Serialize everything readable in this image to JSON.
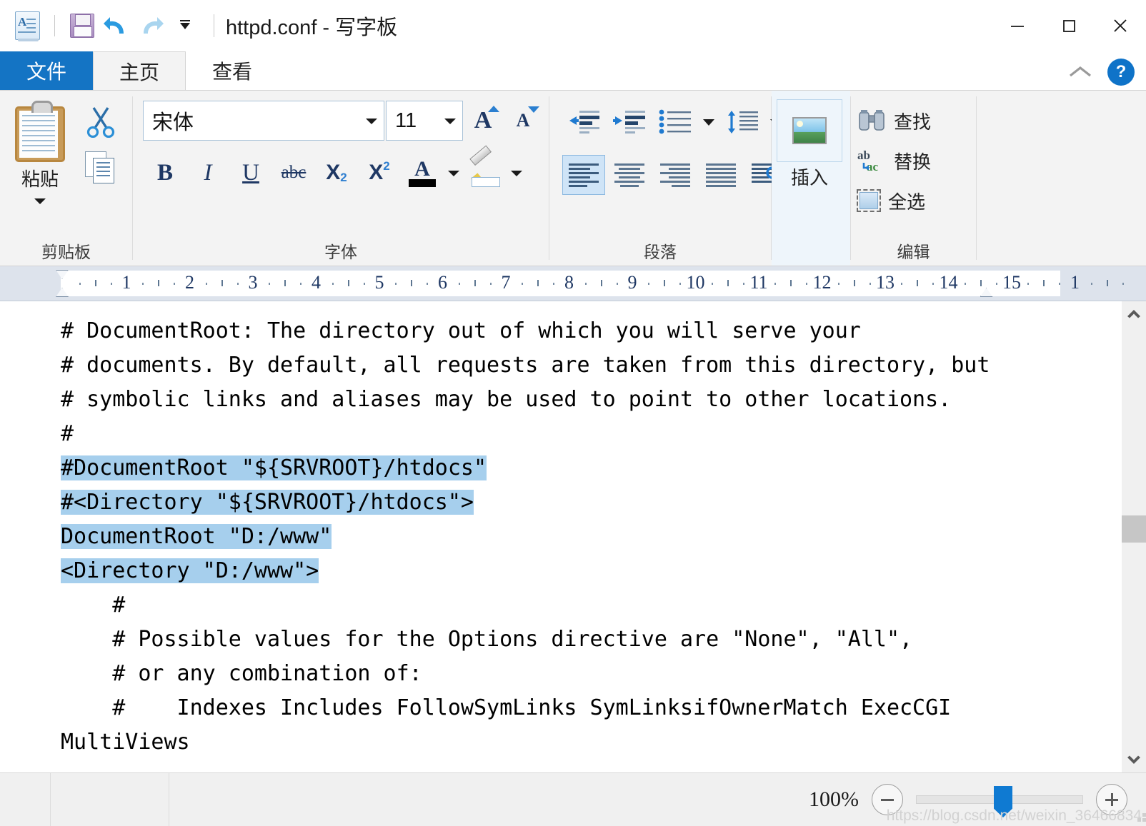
{
  "window": {
    "title": "httpd.conf - 写字板",
    "quick_access": [
      {
        "name": "wordpad-app-icon",
        "label": "写字板"
      },
      {
        "name": "save-icon",
        "label": "保存"
      },
      {
        "name": "undo-icon",
        "label": "撤消"
      },
      {
        "name": "redo-icon",
        "label": "恢复"
      },
      {
        "name": "customize-qat-icon",
        "label": "自定义快速访问工具栏"
      }
    ],
    "controls": {
      "minimize": "—",
      "maximize": "□",
      "close": "✕"
    }
  },
  "tabs": [
    {
      "label": "文件",
      "name": "tab-file"
    },
    {
      "label": "主页",
      "name": "tab-home"
    },
    {
      "label": "查看",
      "name": "tab-view"
    }
  ],
  "ribbon_right": {
    "collapse": "⌃",
    "help": "?"
  },
  "ribbon": {
    "clipboard": {
      "group_label": "剪贴板",
      "paste_label": "粘贴",
      "cut_label": "剪切",
      "copy_label": "复制"
    },
    "font": {
      "group_label": "字体",
      "font_family": "宋体",
      "font_size": "11",
      "grow_label": "增大字号",
      "shrink_label": "减小字号",
      "bold": "B",
      "italic": "I",
      "underline": "U",
      "strikethrough": "abc",
      "subscript": "X",
      "subscript_idx": "2",
      "superscript": "X",
      "superscript_idx": "2",
      "text_color_label": "A",
      "text_color": "#000000",
      "highlight_label": "文本突出显示颜色"
    },
    "paragraph": {
      "group_label": "段落",
      "decrease_indent": "减少缩进量",
      "increase_indent": "增加缩进量",
      "bullets": "开始列表",
      "line_spacing": "行距",
      "align_left": "左对齐",
      "align_center": "居中",
      "align_right": "右对齐",
      "align_justify": "两端对齐",
      "paragraph_marks": "段落"
    },
    "insert": {
      "button_label": "插入",
      "picture_label": "图片"
    },
    "editing": {
      "group_label": "编辑",
      "items": [
        {
          "label": "查找",
          "icon": "binoculars-icon",
          "name": "find-button"
        },
        {
          "label": "替换",
          "icon": "replace-icon",
          "name": "replace-button"
        },
        {
          "label": "全选",
          "icon": "select-all-icon",
          "name": "select-all-button"
        }
      ]
    }
  },
  "ruler": {
    "numbers": [
      "1",
      "2",
      "3",
      "4",
      "5",
      "6",
      "7",
      "8",
      "9",
      "10",
      "11",
      "12",
      "13",
      "14",
      "15",
      "1"
    ],
    "unit": "cm"
  },
  "document": {
    "lines": [
      {
        "text": "# DocumentRoot: The directory out of which you will serve your",
        "selected": false
      },
      {
        "text": "# documents. By default, all requests are taken from this directory, but",
        "selected": false
      },
      {
        "text": "# symbolic links and aliases may be used to point to other locations.",
        "selected": false
      },
      {
        "text": "#",
        "selected": false
      },
      {
        "text": "#DocumentRoot \"${SRVROOT}/htdocs\"",
        "selected": true
      },
      {
        "text": "#<Directory \"${SRVROOT}/htdocs\">",
        "selected": true
      },
      {
        "text": "DocumentRoot \"D:/www\"",
        "selected": true
      },
      {
        "text": "<Directory \"D:/www\">",
        "selected": true
      },
      {
        "text": "    #",
        "selected": false
      },
      {
        "text": "    # Possible values for the Options directive are \"None\", \"All\",",
        "selected": false
      },
      {
        "text": "    # or any combination of:",
        "selected": false
      },
      {
        "text": "    #    Indexes Includes FollowSymLinks SymLinksifOwnerMatch ExecCGI",
        "selected": false
      },
      {
        "text": "MultiViews",
        "selected": false
      }
    ],
    "selection_color": "#a6cfed"
  },
  "statusbar": {
    "zoom_percent": "100%",
    "zoom_out": "−",
    "zoom_in": "+",
    "watermark": "https://blog.csdn.net/weixin_36466834"
  }
}
